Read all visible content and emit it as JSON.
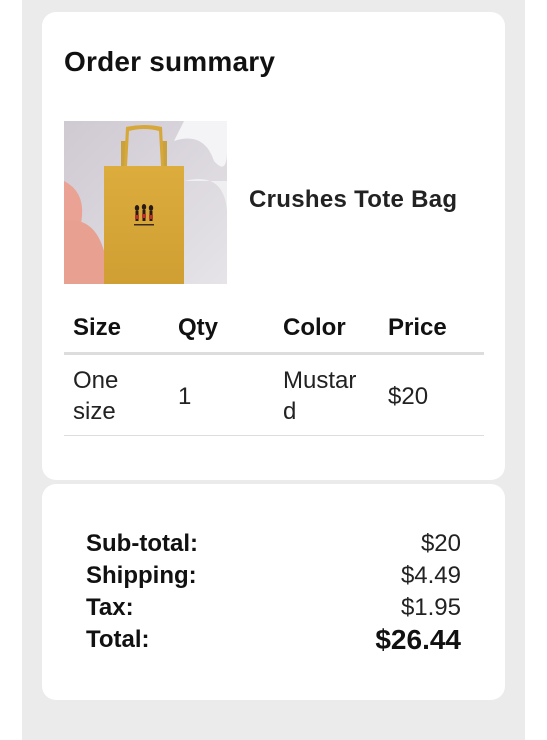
{
  "order": {
    "title": "Order summary",
    "product": {
      "name": "Crushes Tote Bag",
      "image_icon": "tote-bag-image",
      "colors": {
        "bag": "#d9a93a",
        "background_pink": "#e8a196",
        "background_gray": "#d9d7da"
      }
    },
    "table": {
      "headers": [
        "Size",
        "Qty",
        "Color",
        "Price"
      ],
      "row": {
        "size": "One size",
        "qty": "1",
        "color": "Mustard",
        "price": "$20"
      }
    }
  },
  "totals": {
    "subtotal_label": "Sub-total:",
    "subtotal_value": "$20",
    "shipping_label": "Shipping:",
    "shipping_value": "$4.49",
    "tax_label": "Tax:",
    "tax_value": "$1.95",
    "total_label": "Total:",
    "total_value": "$26.44"
  }
}
